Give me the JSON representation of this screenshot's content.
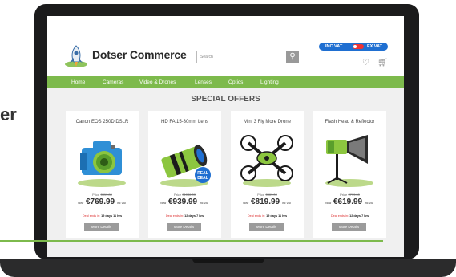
{
  "side_text": "er",
  "brand": {
    "name": "Dotser Commerce"
  },
  "search": {
    "placeholder": "Search"
  },
  "vat_toggle": {
    "left_label": "INC VAT",
    "right_label": "EX VAT"
  },
  "nav": {
    "items": [
      "Home",
      "Cameras",
      "Video & Drones",
      "Lenses",
      "Optics",
      "Lighting"
    ]
  },
  "section_title": "SPECIAL OFFERS",
  "products": [
    {
      "name": "Canon EOS 250D DSLR",
      "was_label": "Price",
      "was_price": "€819.80",
      "now_label": "Now",
      "price": "€769.99",
      "price_suffix": "Inc VAT",
      "deal_prefix": "Deal ends in:",
      "deal_time": "19 days 11 hrs",
      "button": "More Details"
    },
    {
      "name": "HD FA 15-30mm Lens",
      "was_label": "Price",
      "was_price": "€1086.00",
      "now_label": "Now",
      "price": "€939.99",
      "price_suffix": "Inc VAT",
      "deal_prefix": "Deal ends in:",
      "deal_time": "12 days 7 hrs",
      "button": "More Details",
      "badge": "REAL DEAL"
    },
    {
      "name": "Mini 3 Fly More Drone",
      "was_label": "Price",
      "was_price": "€869.00",
      "now_label": "Now",
      "price": "€819.99",
      "price_suffix": "Inc VAT",
      "deal_prefix": "Deal ends in:",
      "deal_time": "19 days 11 hrs",
      "button": "More Details"
    },
    {
      "name": "Flash Head & Reflector",
      "was_label": "Price",
      "was_price": "€799.00",
      "now_label": "Now",
      "price": "€619.99",
      "price_suffix": "Inc VAT",
      "deal_prefix": "Deal ends in:",
      "deal_time": "12 days 7 hrs",
      "button": "More Details"
    }
  ],
  "colors": {
    "accent_green": "#7dba4c",
    "toggle_blue": "#1f6fd1",
    "deal_red": "#dd3333"
  }
}
